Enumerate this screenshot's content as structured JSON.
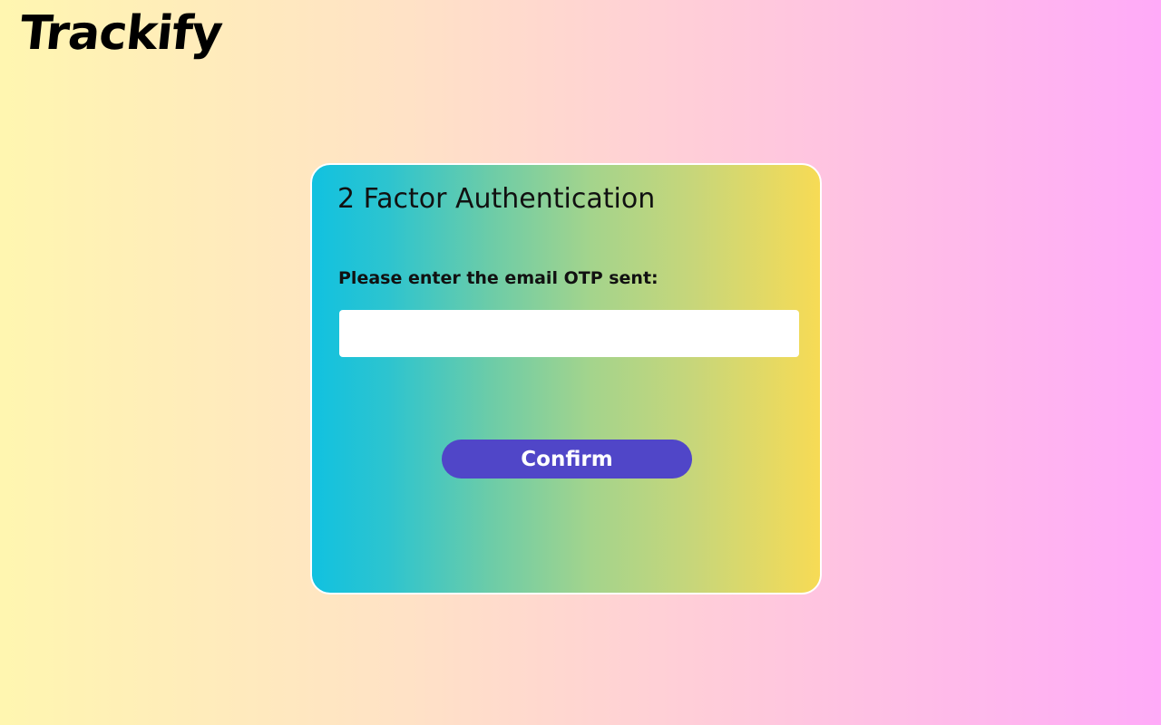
{
  "app": {
    "logo_text": "Trackify"
  },
  "auth_card": {
    "title": "2 Factor Authentication",
    "otp_label": "Please enter the email OTP sent:",
    "otp_value": "",
    "confirm_label": "Confirm"
  },
  "colors": {
    "button": "#5046c8",
    "card_gradient_start": "#11c1e0",
    "card_gradient_end": "#f7db55",
    "page_gradient_start": "#fff6b0",
    "page_gradient_end": "#ffaaf8"
  }
}
